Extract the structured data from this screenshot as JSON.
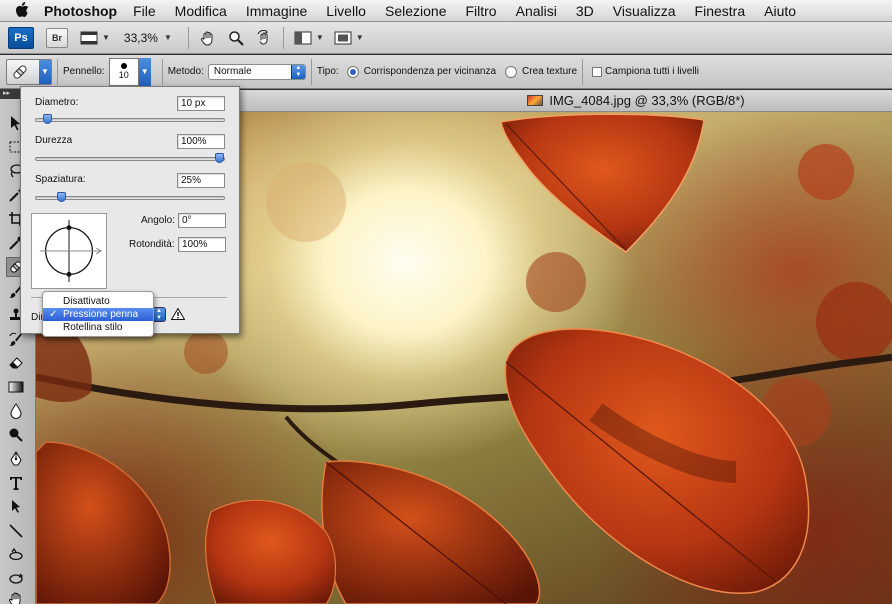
{
  "menubar": {
    "app_name": "Photoshop",
    "items": [
      "File",
      "Modifica",
      "Immagine",
      "Livello",
      "Selezione",
      "Filtro",
      "Analisi",
      "3D",
      "Visualizza",
      "Finestra",
      "Aiuto"
    ]
  },
  "appbar": {
    "ps_label": "Ps",
    "br_label": "Br",
    "zoom": "33,3%"
  },
  "options": {
    "brush_label": "Pennello:",
    "brush_size": "10",
    "mode_label": "Metodo:",
    "mode_value": "Normale",
    "type_label": "Tipo:",
    "type_options": [
      "Corrispondenza per vicinanza",
      "Crea texture"
    ],
    "type_selected": 0,
    "sample_all_label": "Campiona tutti i livelli"
  },
  "document": {
    "title": "IMG_4084.jpg @ 33,3% (RGB/8*)"
  },
  "brush_panel": {
    "diameter_label": "Diametro:",
    "diameter_value": "10 px",
    "diameter_slider": 0.04,
    "hardness_label": "Durezza",
    "hardness_value": "100%",
    "hardness_slider": 1.0,
    "spacing_label": "Spaziatura:",
    "spacing_value": "25%",
    "spacing_slider": 0.12,
    "angle_label": "Angolo:",
    "angle_value": "0°",
    "roundness_label": "Rotondità:",
    "roundness_value": "100%",
    "control_label": "Dim"
  },
  "dropdown": {
    "items": [
      "Disattivato",
      "Pressione penna",
      "Rotellina stilo"
    ],
    "selected": 1,
    "check_glyph": "✓"
  },
  "colors": {
    "accent": "#2b5fd6",
    "ps_blue": "#0a4c98"
  }
}
